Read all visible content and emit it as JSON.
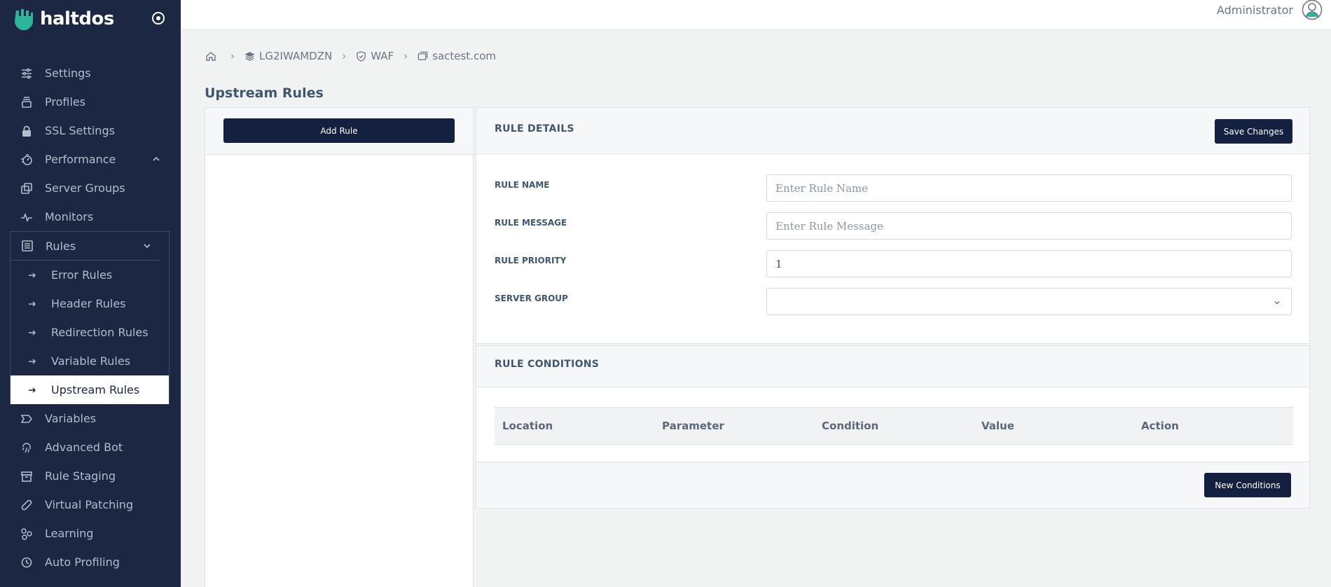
{
  "app": {
    "logo_text": "haltdos"
  },
  "sidebar": {
    "items": [
      {
        "label": "Settings",
        "icon": "sliders-icon"
      },
      {
        "label": "Profiles",
        "icon": "stack-icon"
      },
      {
        "label": "SSL Settings",
        "icon": "lock-icon"
      },
      {
        "label": "Performance",
        "icon": "gauge-icon",
        "chevron": "up"
      },
      {
        "label": "Server Groups",
        "icon": "copy-icon"
      },
      {
        "label": "Monitors",
        "icon": "activity-icon"
      }
    ],
    "rules": {
      "label": "Rules",
      "icon": "list-icon",
      "sub_items": [
        {
          "label": "Error Rules"
        },
        {
          "label": "Header Rules"
        },
        {
          "label": "Redirection Rules"
        },
        {
          "label": "Variable Rules"
        },
        {
          "label": "Upstream Rules",
          "active": true
        }
      ]
    },
    "bottom_items": [
      {
        "label": "Variables",
        "icon": "tag-icon"
      },
      {
        "label": "Advanced Bot",
        "icon": "fingerprint-icon"
      },
      {
        "label": "Rule Staging",
        "icon": "archive-icon"
      },
      {
        "label": "Virtual Patching",
        "icon": "bandage-icon"
      },
      {
        "label": "Learning",
        "icon": "nodes-icon"
      },
      {
        "label": "Auto Profiling",
        "icon": "history-icon"
      }
    ]
  },
  "topbar": {
    "user_name": "Administrator"
  },
  "breadcrumb": {
    "device": "LG2IWAMDZN",
    "module": "WAF",
    "site": "sactest.com"
  },
  "page": {
    "title": "Upstream Rules"
  },
  "rules_panel": {
    "add_rule_label": "Add Rule"
  },
  "details": {
    "title": "RULE DETAILS",
    "save_label": "Save Changes",
    "fields": {
      "rule_name": {
        "label": "RULE NAME",
        "placeholder": "Enter Rule Name",
        "value": ""
      },
      "rule_message": {
        "label": "RULE MESSAGE",
        "placeholder": "Enter Rule Message",
        "value": ""
      },
      "rule_priority": {
        "label": "RULE PRIORITY",
        "value": "1"
      },
      "server_group": {
        "label": "SERVER GROUP",
        "value": ""
      }
    }
  },
  "conditions": {
    "title": "RULE CONDITIONS",
    "columns": [
      "Location",
      "Parameter",
      "Condition",
      "Value",
      "Action"
    ],
    "new_label": "New Conditions"
  },
  "colors": {
    "sidebar_bg": "#1c2743",
    "button_dark": "#13203f",
    "logo_accent": "#2bb59a"
  }
}
